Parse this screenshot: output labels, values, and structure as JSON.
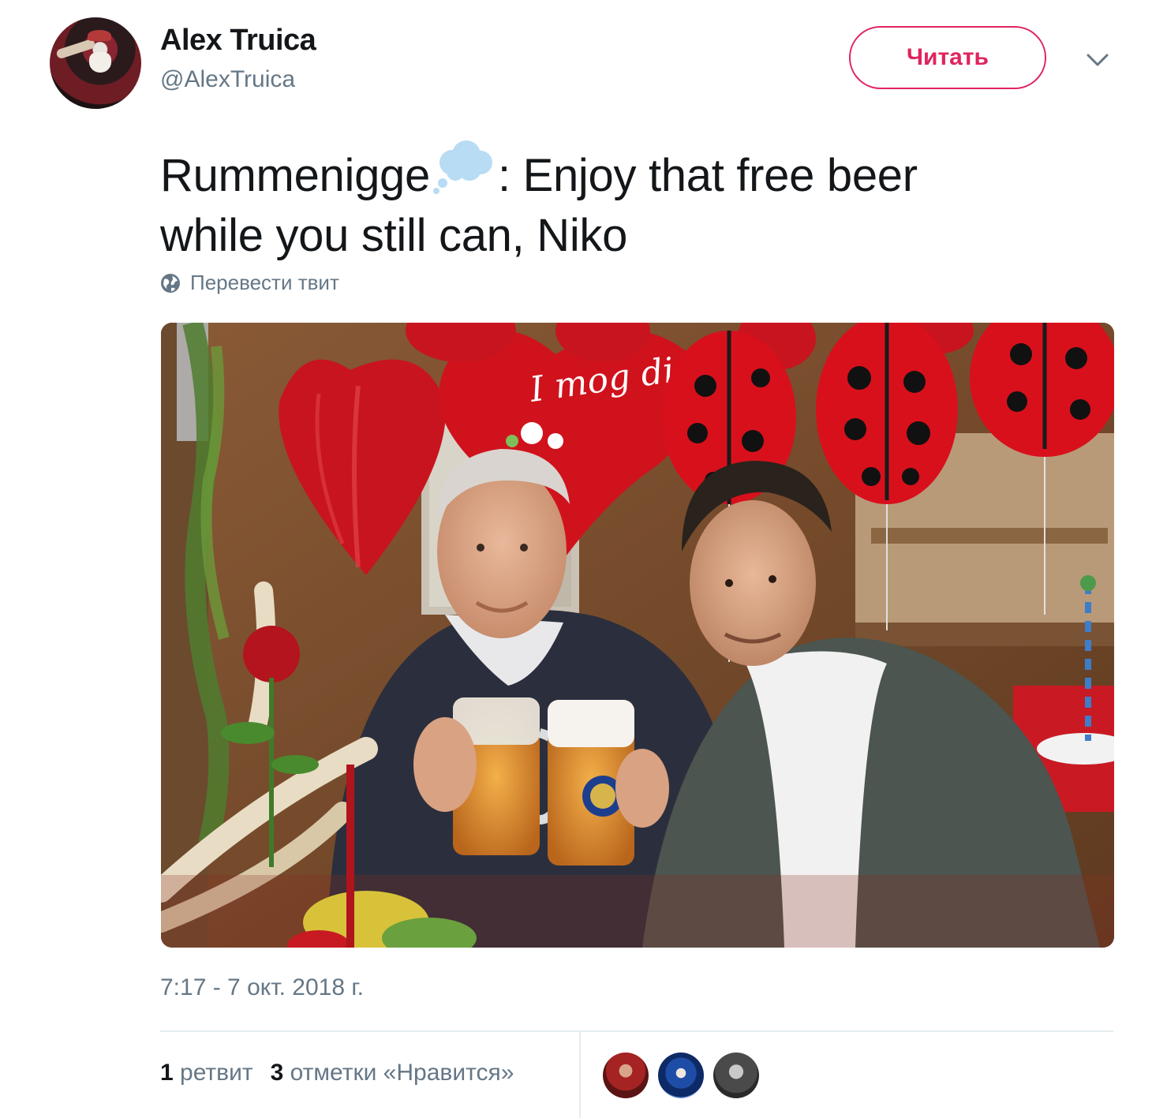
{
  "tweet": {
    "author": {
      "display_name": "Alex Truica",
      "screen_name": "@AlexTruica"
    },
    "follow_label": "Читать",
    "text": {
      "line1_before": "Rummenigge",
      "line1_after": ": Enjoy that free beer",
      "line2": "while you still can, Niko",
      "emoji": "thought-balloon"
    },
    "translate_label": "Перевести твит",
    "media": {
      "balloon_text": "I mog di"
    },
    "timestamp": "7:17 - 7 окт. 2018 г.",
    "stats": {
      "retweets_count": "1",
      "retweets_label": "ретвит",
      "likes_count": "3",
      "likes_label": "отметки «Нравится»"
    },
    "likers_count_shown": 3
  },
  "colors": {
    "accent": "#e0245e",
    "secondary_text": "#657786",
    "primary_text": "#14171a",
    "divider": "#e6ecf0"
  },
  "icons": {
    "caret": "chevron-down-icon",
    "translate": "globe-icon"
  }
}
